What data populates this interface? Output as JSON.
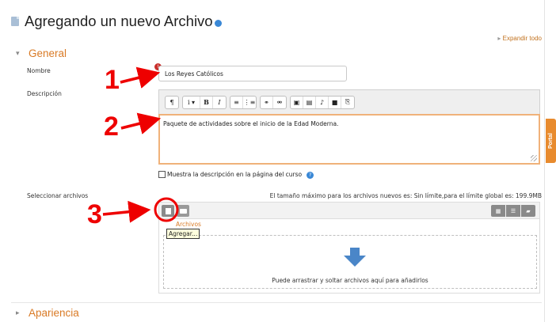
{
  "page": {
    "title": "Agregando un nuevo Archivo",
    "expand_all": "Expandir todo"
  },
  "sections": {
    "general": "General",
    "appearance": "Apariencia"
  },
  "form": {
    "name_label": "Nombre",
    "name_value": "Los Reyes Católicos",
    "description_label": "Descripción",
    "description_value": "Paquete de actividades sobre el inicio de la Edad Moderna.",
    "show_description_label": "Muestra la descripción en la página del curso",
    "select_files_label": "Seleccionar archivos",
    "max_size_text": "El tamaño máximo para los archivos nuevos es: Sin límite,para el límite global es: 199.9MB"
  },
  "editor_toolbar": {
    "groups": [
      [
        "¶"
      ],
      [
        "i ▾",
        "B",
        "I"
      ],
      [
        "≡",
        "⋮≡"
      ],
      [
        "⚭",
        "⚮"
      ],
      [
        "▣",
        "▤",
        "♪",
        "■",
        "⎘"
      ]
    ]
  },
  "file_picker": {
    "files_tab": "Archivos",
    "tooltip": "Agregar...",
    "drop_text": "Puede arrastrar y soltar archivos aquí para añadirlos"
  },
  "side_tab": {
    "label": "Portal"
  },
  "annotations": [
    "1",
    "2",
    "3"
  ],
  "colors": {
    "accent": "#d97a25",
    "annotation_red": "#ee0000",
    "editor_focus_border": "#f0b27a",
    "help_blue": "#3a88d6"
  }
}
